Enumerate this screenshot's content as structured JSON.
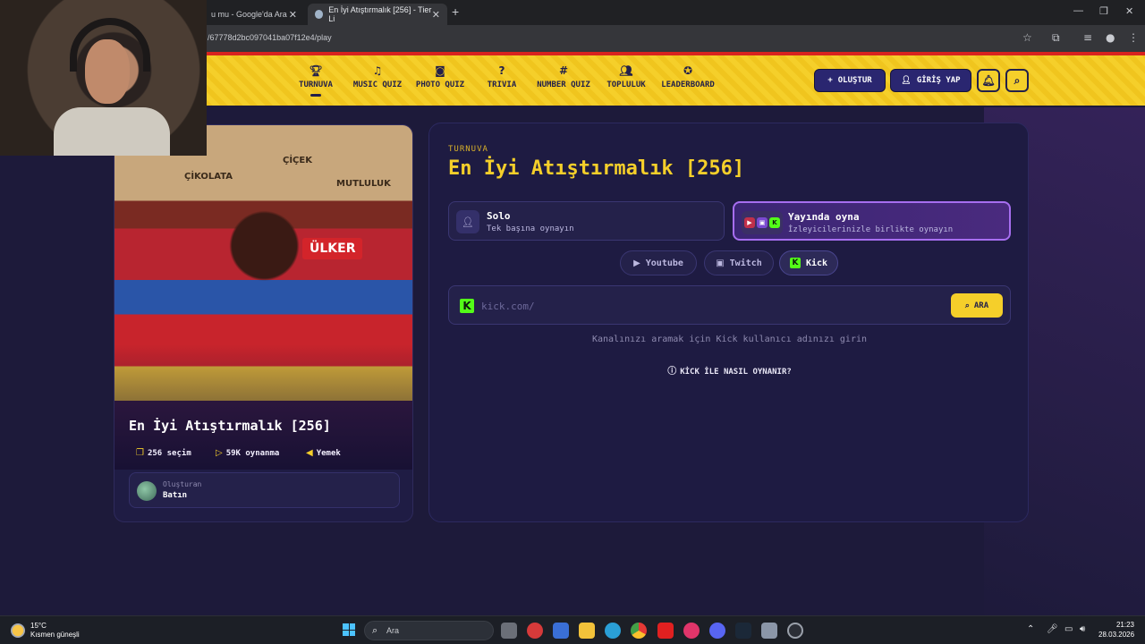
{
  "browser": {
    "tabs": [
      {
        "label": "u mu - Google'da Ara"
      },
      {
        "label": "En İyi Atıştırmalık [256] - Tier Li"
      }
    ],
    "url": "/67778d2bc097041ba07f12e4/play"
  },
  "nav": {
    "items": [
      {
        "label": "TURNUVA",
        "icon": "trophy-icon"
      },
      {
        "label": "MUSIC QUIZ",
        "icon": "music-note-icon"
      },
      {
        "label": "PHOTO QUIZ",
        "icon": "camera-icon"
      },
      {
        "label": "TRIVIA",
        "icon": "question-circle-icon"
      },
      {
        "label": "NUMBER QUIZ",
        "icon": "hash-icon"
      },
      {
        "label": "TOPLULUK",
        "icon": "users-icon"
      },
      {
        "label": "LEADERBOARD",
        "icon": "medal-icon"
      }
    ],
    "create_label": "OLUŞTUR",
    "login_label": "GİRİŞ YAP"
  },
  "card": {
    "photo_texts": [
      "ÇİKOLATA",
      "ÇİÇEK",
      "MUTLULUK",
      "ÜLKER"
    ],
    "title": "En İyi Atıştırmalık [256]",
    "stats": {
      "choices": "256 seçim",
      "plays": "59K oynanma",
      "category": "Yemek"
    },
    "creator_label": "Oluşturan",
    "creator_name": "Batın"
  },
  "panel": {
    "eyebrow": "TURNUVA",
    "title": "En İyi Atıştırmalık [256]",
    "modes": {
      "solo": {
        "title": "Solo",
        "subtitle": "Tek başına oynayın"
      },
      "live": {
        "title": "Yayında oyna",
        "subtitle": "İzleyicilerinizle birlikte oynayın"
      }
    },
    "platforms": {
      "youtube": "Youtube",
      "twitch": "Twitch",
      "kick": "Kick"
    },
    "search": {
      "placeholder": "kick.com/",
      "value": "",
      "button": "ARA"
    },
    "hint": "Kanalınızı aramak için Kick kullanıcı adınızı girin",
    "howto": "KİCK İLE NASIL OYNANIR?"
  },
  "taskbar": {
    "weather_temp": "15°C",
    "weather_desc": "Kısmen güneşli",
    "search_label": "Ara",
    "time": "21:23",
    "date": "28.03.2026"
  },
  "colors": {
    "accent_yellow": "#f5cf2a",
    "navy": "#1e1b42",
    "kick_green": "#53fc18",
    "live_purple": "#a76ef0"
  }
}
